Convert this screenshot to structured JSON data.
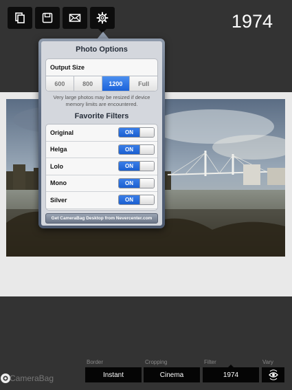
{
  "header": {
    "title": "1974",
    "tools": [
      {
        "icon": "copy-icon"
      },
      {
        "icon": "save-icon"
      },
      {
        "icon": "mail-icon"
      },
      {
        "icon": "gear-icon"
      }
    ]
  },
  "popover": {
    "title": "Photo Options",
    "output_size": {
      "label": "Output Size",
      "options": [
        "600",
        "800",
        "1200",
        "Full"
      ],
      "selected": "1200"
    },
    "note": "Very large photos may be resized if device memory limits are encountered.",
    "filters_title": "Favorite Filters",
    "filters": [
      {
        "name": "Original",
        "state": "ON"
      },
      {
        "name": "Helga",
        "state": "ON"
      },
      {
        "name": "Lolo",
        "state": "ON"
      },
      {
        "name": "Mono",
        "state": "ON"
      },
      {
        "name": "Silver",
        "state": "ON"
      }
    ],
    "desktop_link": "Get CameraBag Desktop from Nevercenter.com"
  },
  "bottom_bar": {
    "brand": "CameraBag",
    "border": {
      "label": "Border",
      "value": "Instant"
    },
    "cropping": {
      "label": "Cropping",
      "value": "Cinema"
    },
    "filter": {
      "label": "Filter",
      "value": "1974"
    },
    "vary": {
      "label": "Vary",
      "icon": "eye-cycle-icon"
    }
  },
  "colors": {
    "accent": "#1b62d9",
    "popover_frame": "#5c6a80",
    "background": "#333333"
  }
}
